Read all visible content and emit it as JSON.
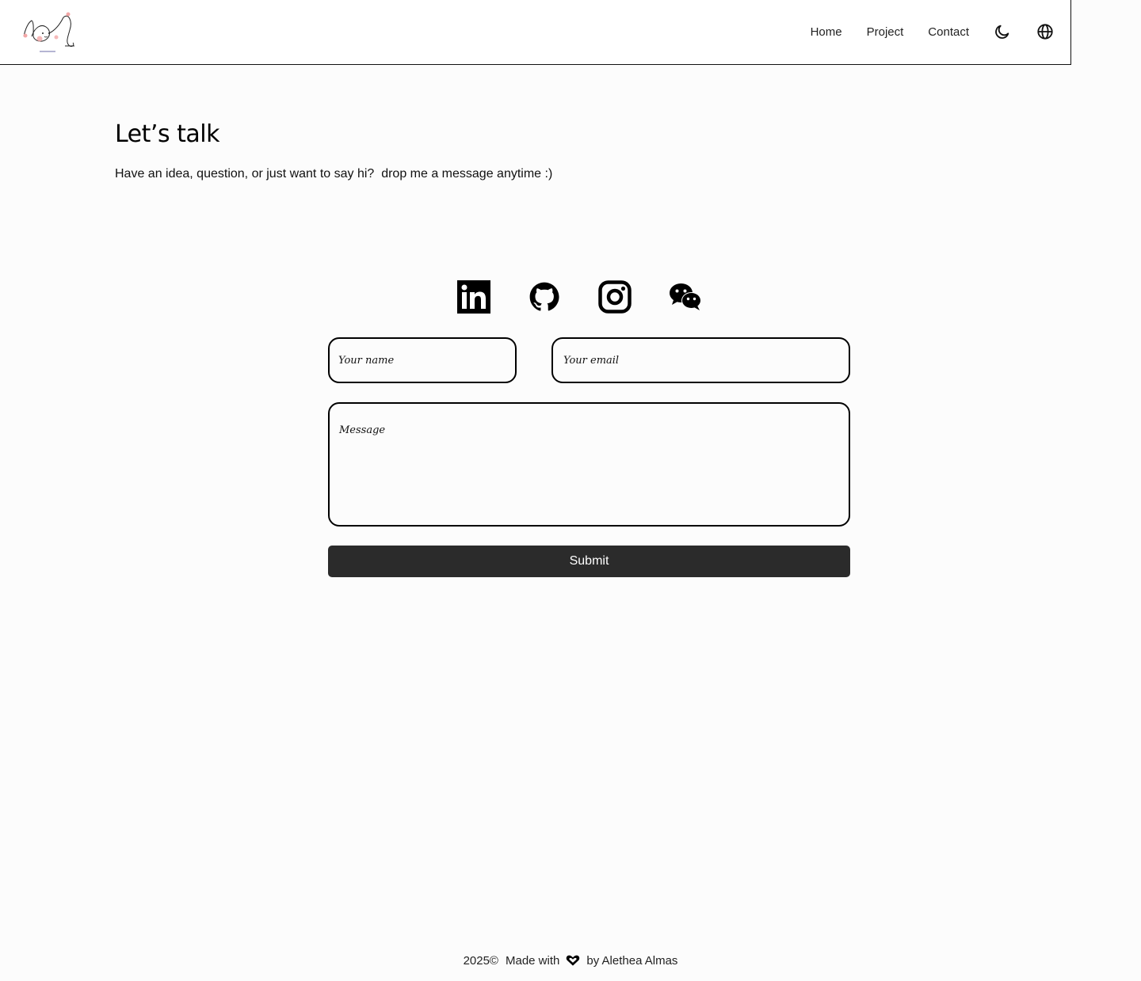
{
  "header": {
    "nav": [
      {
        "label": "Home"
      },
      {
        "label": "Project"
      },
      {
        "label": "Contact"
      }
    ],
    "icons": [
      "moon-icon",
      "globe-icon"
    ]
  },
  "main": {
    "title": "Let’s talk",
    "subtitle": "Have an idea, question, or just want to say hi?  drop me a message anytime :)"
  },
  "social": [
    "linkedin-icon",
    "github-icon",
    "instagram-icon",
    "wechat-icon"
  ],
  "form": {
    "name_placeholder": "Your name",
    "email_placeholder": "Your email",
    "message_placeholder": "Message",
    "submit_label": "Submit"
  },
  "footer": {
    "year": "2025©",
    "made_with": "Made with",
    "by": "by Alethea Almas"
  },
  "colors": {
    "background": "#fcfcfc",
    "button": "#2b2b2b",
    "logo_accent": "#f2a7a7"
  }
}
